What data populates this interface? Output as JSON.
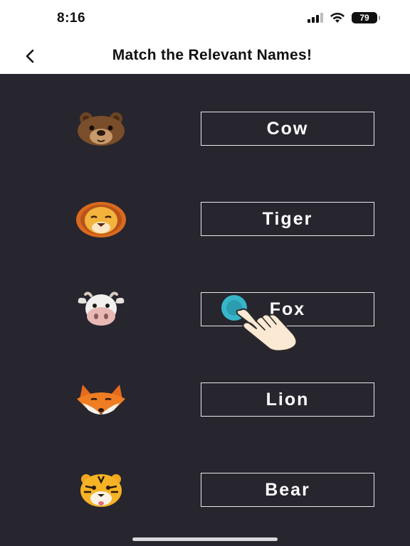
{
  "status_bar": {
    "time": "8:16",
    "battery": "79"
  },
  "header": {
    "title": "Match the Relevant Names!"
  },
  "animals": [
    {
      "icon": "bear-face-icon"
    },
    {
      "icon": "lion-face-icon"
    },
    {
      "icon": "cow-face-icon"
    },
    {
      "icon": "fox-face-icon"
    },
    {
      "icon": "tiger-face-icon"
    }
  ],
  "names": [
    "Cow",
    "Tiger",
    "Fox",
    "Lion",
    "Bear"
  ],
  "colors": {
    "background": "#27252e",
    "box_border": "#e9e9ee",
    "hand_dot": "#38b6c9"
  }
}
